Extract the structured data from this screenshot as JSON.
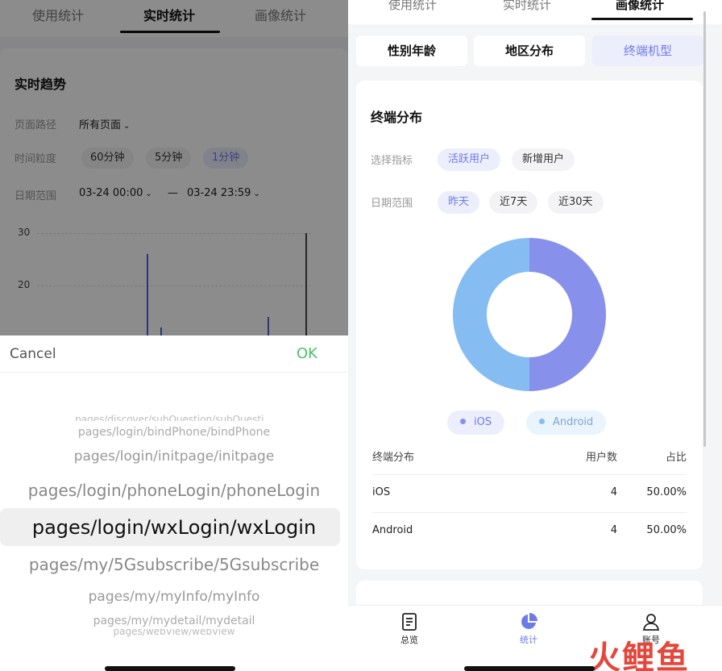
{
  "left": {
    "tabs": [
      "使用统计",
      "实时统计",
      "画像统计"
    ],
    "card_title": "实时趋势",
    "filters": {
      "path_label": "页面路径",
      "path_value": "所有页面",
      "granularity_label": "时间粒度",
      "granularity_options": [
        "60分钟",
        "5分钟",
        "1分钟"
      ],
      "granularity_selected": "1分钟",
      "date_label": "日期范围",
      "date_start": "03-24 00:00",
      "date_sep": "—",
      "date_end": "03-24 23:59"
    },
    "chart_data": {
      "type": "bar",
      "y_ticks": [
        "30",
        "20"
      ],
      "visible_bars": [
        {
          "label": "bar-a",
          "value": 26
        },
        {
          "label": "bar-b",
          "value": 12
        },
        {
          "label": "bar-c",
          "value": 14
        },
        {
          "label": "bar-d",
          "value": 30
        }
      ]
    },
    "picker": {
      "cancel_label": "Cancel",
      "ok_label": "OK",
      "options": [
        "pages/discover/subQuestion/subQuesti...",
        "pages/login/bindPhone/bindPhone",
        "pages/login/initpage/initpage",
        "pages/login/phoneLogin/phoneLogin",
        "pages/login/wxLogin/wxLogin",
        "pages/my/5Gsubscribe/5Gsubscribe",
        "pages/my/myInfo/myInfo",
        "pages/my/mydetail/mydetail",
        "pages/webView/webView"
      ],
      "selected_index": 4
    }
  },
  "right": {
    "tabs": [
      "使用统计",
      "实时统计",
      "画像统计"
    ],
    "segments": [
      "性别年龄",
      "地区分布",
      "终端机型"
    ],
    "segment_selected": "终端机型",
    "card_title": "终端分布",
    "metric_label": "选择指标",
    "metric_options": [
      "活跃用户",
      "新增用户"
    ],
    "metric_selected": "活跃用户",
    "range_label": "日期范围",
    "range_options": [
      "昨天",
      "近7天",
      "近30天"
    ],
    "range_selected": "昨天",
    "chart_data": {
      "type": "pie",
      "categories": [
        "iOS",
        "Android"
      ],
      "values": [
        4,
        4
      ],
      "colors": [
        "#8790ea",
        "#85bdf2"
      ]
    },
    "legend": [
      {
        "label": "iOS",
        "color": "#8790ea",
        "bg": "#eceefc",
        "text_color": "#6e7ae8"
      },
      {
        "label": "Android",
        "color": "#85bdf2",
        "bg": "#eaf4fd",
        "text_color": "#7fa6cf"
      }
    ],
    "table": {
      "headers": [
        "终端分布",
        "用户数",
        "占比"
      ],
      "rows": [
        [
          "iOS",
          "4",
          "50.00%"
        ],
        [
          "Android",
          "4",
          "50.00%"
        ]
      ]
    },
    "tabbar": [
      {
        "label": "总览",
        "icon": "document-icon"
      },
      {
        "label": "统计",
        "icon": "pie-chart-icon"
      },
      {
        "label": "账号",
        "icon": "user-icon"
      }
    ],
    "active_tab": "统计"
  },
  "watermark": "火鲤鱼"
}
